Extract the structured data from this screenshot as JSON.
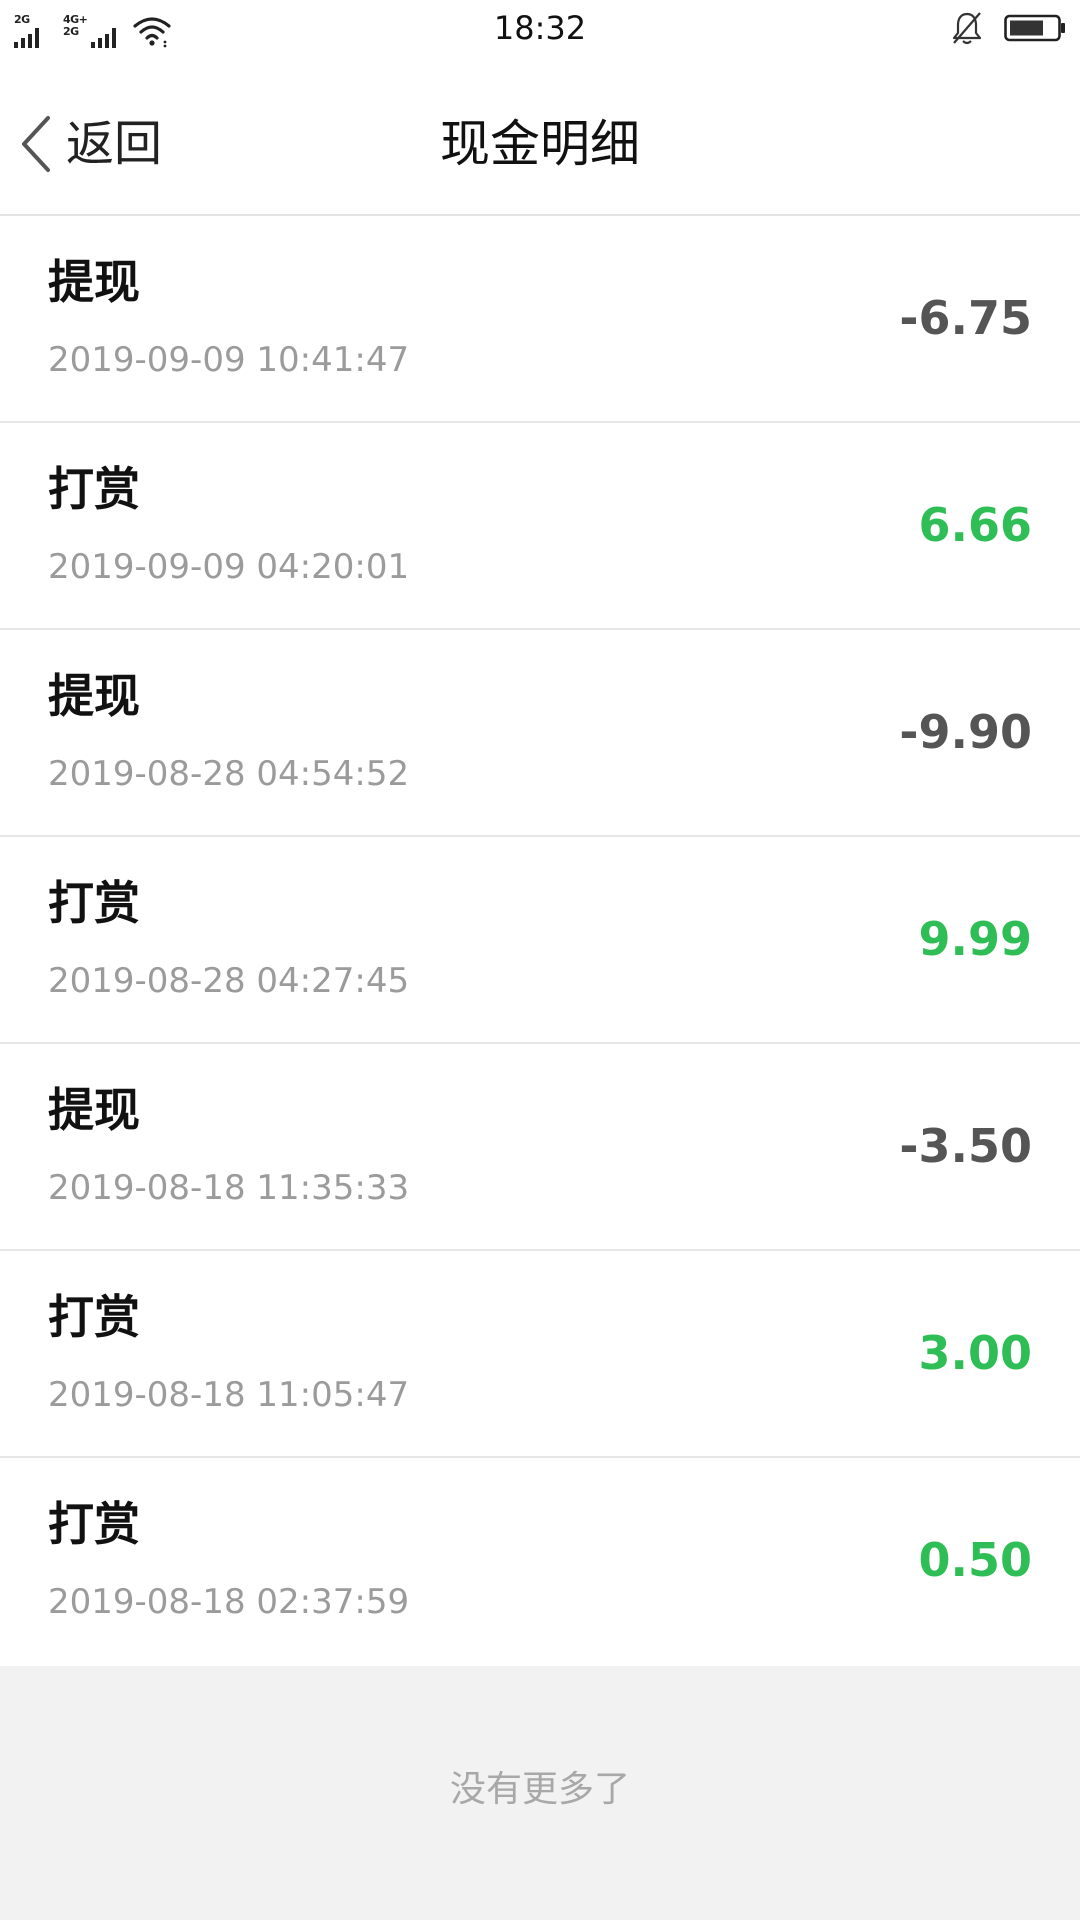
{
  "status_bar": {
    "signal1_tag": "2G",
    "signal2_tag_top": "4G+",
    "signal2_tag_bottom": "2G",
    "time": "18:32",
    "icons": [
      "signal-icon",
      "signal-icon",
      "wifi-icon",
      "bell-off-icon",
      "battery-icon"
    ]
  },
  "header": {
    "back_label": "返回",
    "title": "现金明细"
  },
  "transactions": [
    {
      "type": "提现",
      "time": "2019-09-09 10:41:47",
      "amount": "-6.75",
      "kind": "neg"
    },
    {
      "type": "打赏",
      "time": "2019-09-09 04:20:01",
      "amount": "6.66",
      "kind": "pos"
    },
    {
      "type": "提现",
      "time": "2019-08-28 04:54:52",
      "amount": "-9.90",
      "kind": "neg"
    },
    {
      "type": "打赏",
      "time": "2019-08-28 04:27:45",
      "amount": "9.99",
      "kind": "pos"
    },
    {
      "type": "提现",
      "time": "2019-08-18 11:35:33",
      "amount": "-3.50",
      "kind": "neg"
    },
    {
      "type": "打赏",
      "time": "2019-08-18 11:05:47",
      "amount": "3.00",
      "kind": "pos"
    },
    {
      "type": "打赏",
      "time": "2019-08-18 02:37:59",
      "amount": "0.50",
      "kind": "pos"
    }
  ],
  "footer": {
    "no_more": "没有更多了"
  },
  "colors": {
    "positive": "#2fbd56",
    "negative": "#555555",
    "page_bg": "#f2f2f2"
  }
}
